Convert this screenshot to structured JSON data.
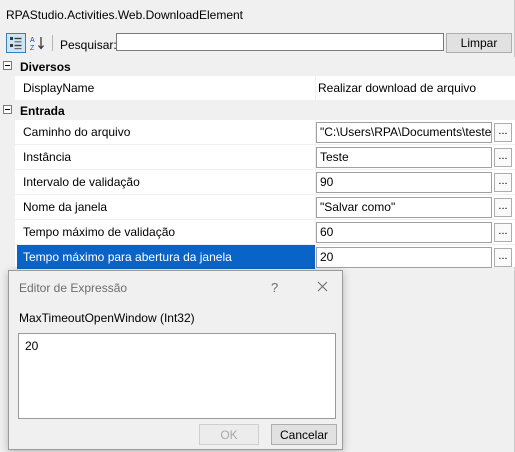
{
  "grid": {
    "title": "RPAStudio.Activities.Web.DownloadElement",
    "toolbar": {
      "search_label": "Pesquisar:",
      "search_value": "",
      "clear_label": "Limpar"
    },
    "categories": [
      {
        "label": "Diversos",
        "properties": [
          {
            "name": "DisplayName",
            "value": "Realizar download de arquivo"
          }
        ]
      },
      {
        "label": "Entrada",
        "properties": [
          {
            "name": "Caminho do arquivo",
            "value": "\"C:\\Users\\RPA\\Documents\\teste",
            "button": "..."
          },
          {
            "name": "Instância",
            "value": "Teste",
            "button": "..."
          },
          {
            "name": "Intervalo de validação",
            "value": "90",
            "button": "..."
          },
          {
            "name": "Nome da janela",
            "value": "\"Salvar como\"",
            "button": "..."
          },
          {
            "name": "Tempo máximo de validação",
            "value": "60",
            "button": "..."
          },
          {
            "name": "Tempo máximo para abertura da janela",
            "value": "20",
            "button": "...",
            "selected": true
          }
        ]
      }
    ]
  },
  "dialog": {
    "title": "Editor de Expressão",
    "help": "?",
    "type_label": "MaxTimeoutOpenWindow (Int32)",
    "expression": "20",
    "ok_label": "OK",
    "cancel_label": "Cancelar"
  }
}
